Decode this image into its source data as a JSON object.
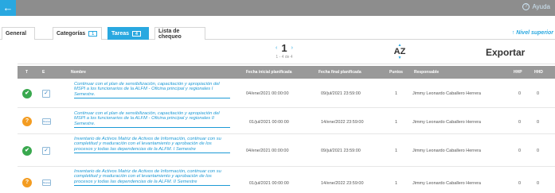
{
  "back_arrow_glyph": "←",
  "help": {
    "label": "Ayuda",
    "glyph": "?"
  },
  "tabs": [
    {
      "label": "General"
    },
    {
      "label": "Categorías",
      "count": "1"
    },
    {
      "label": "Tareas",
      "count": "4"
    },
    {
      "label": "Lista de chequeo"
    }
  ],
  "nivel_superior": "↑ Nivel superior",
  "pager": {
    "prev": "‹",
    "next": "›",
    "page": "1",
    "range": "1 - 4 de 4"
  },
  "sort": {
    "up": "▲",
    "label": "AZ",
    "down": "▼"
  },
  "export_label": "Exportar",
  "columns": {
    "t": "T",
    "e": "E",
    "name": "Nombre",
    "start": "Fecha inicial planificada",
    "end": "Fecha final planificada",
    "points": "Puntos",
    "owner": "Responsable",
    "hhp": "HHP",
    "hhd": "HHD"
  },
  "rows": [
    {
      "status": "done",
      "status_glyph": "✔",
      "state": "check",
      "state_text": "✓",
      "name": "Continuar con el plan de sensibilización, capacitación y apropiación del MSPI a los funcionarios de la ALFM - Oficina principal y regionales I Semestre.",
      "start": "04/ene/2021 00:00:00",
      "end": "09/jul/2021 23:59:00",
      "points": "1",
      "owner": "Jimmy Leonardo Caballero Herrera",
      "hhp": "0",
      "hhd": "0"
    },
    {
      "status": "pending",
      "status_glyph": "?",
      "state": "label",
      "state_text": "Nueva",
      "name": "Continuar con el plan de sensibilización, capacitación y apropiación del MSPI a los funcionarios de la ALFM - Oficina principal y regionales II Semestre.",
      "start": "01/jul/2021 00:00:00",
      "end": "14/ene/2022 23:59:00",
      "points": "1",
      "owner": "Jimmy Leonardo Caballero Herrera",
      "hhp": "0",
      "hhd": "0"
    },
    {
      "status": "done",
      "status_glyph": "✔",
      "state": "check",
      "state_text": "✓",
      "name": "Inventario de Activos Matriz de Activos de Información, continuar con su completitud y maduración con el levantamiento y aprobación de los procesos y todas las dependencias de la ALFM. I Semestre",
      "start": "04/ene/2021 00:00:00",
      "end": "09/jul/2021 23:59:00",
      "points": "1",
      "owner": "Jimmy Leonardo Caballero Herrera",
      "hhp": "0",
      "hhd": "0"
    },
    {
      "status": "pending",
      "status_glyph": "?",
      "state": "label",
      "state_text": "Nueva",
      "name": "Inventario de Activos Matriz de Activos de Información, continuar con su completitud y maduración con el levantamiento y aprobación de los procesos y todas las dependencias de la ALFM. II Semestre",
      "start": "01/jul/2021 00:00:00",
      "end": "14/ene/2022 23:59:00",
      "points": "1",
      "owner": "Jimmy Leonardo Caballero Herrera",
      "hhp": "0",
      "hhd": "0"
    }
  ]
}
